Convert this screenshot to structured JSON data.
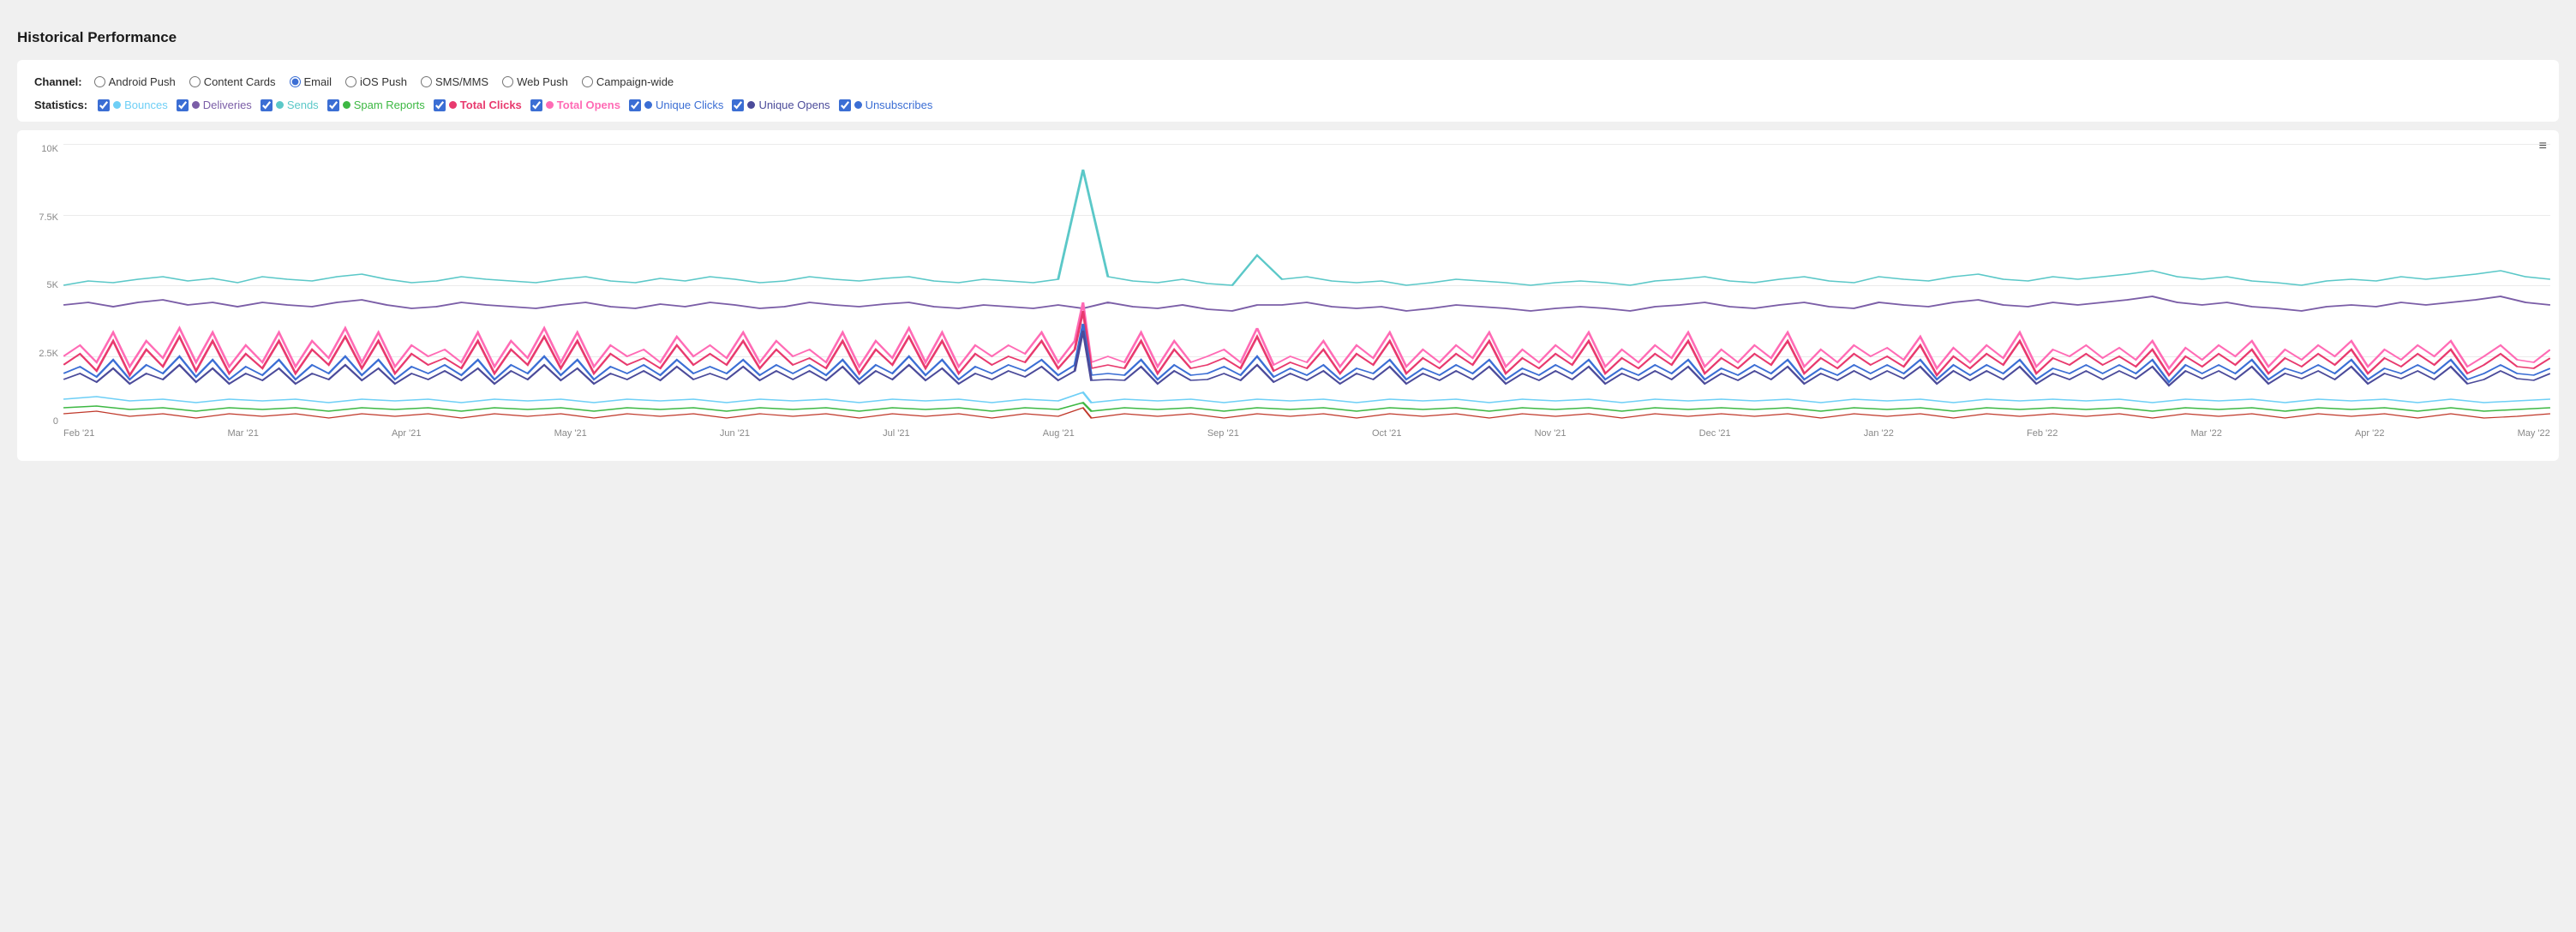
{
  "page": {
    "title": "Historical Performance"
  },
  "channel": {
    "label": "Channel:",
    "options": [
      {
        "id": "android-push",
        "label": "Android Push",
        "checked": false
      },
      {
        "id": "content-cards",
        "label": "Content Cards",
        "checked": false
      },
      {
        "id": "email",
        "label": "Email",
        "checked": true
      },
      {
        "id": "ios-push",
        "label": "iOS Push",
        "checked": false
      },
      {
        "id": "sms-mms",
        "label": "SMS/MMS",
        "checked": false
      },
      {
        "id": "web-push",
        "label": "Web Push",
        "checked": false
      },
      {
        "id": "campaign-wide",
        "label": "Campaign-wide",
        "checked": false
      }
    ]
  },
  "statistics": {
    "label": "Statistics:",
    "options": [
      {
        "id": "bounces",
        "label": "Bounces",
        "color": "#6ecff6",
        "checked": true
      },
      {
        "id": "deliveries",
        "label": "Deliveries",
        "color": "#7b5ea7",
        "checked": true
      },
      {
        "id": "sends",
        "label": "Sends",
        "color": "#5bc8c8",
        "checked": true
      },
      {
        "id": "spam-reports",
        "label": "Spam Reports",
        "color": "#3db843",
        "checked": true
      },
      {
        "id": "total-clicks",
        "label": "Total Clicks",
        "color": "#e83a6e",
        "checked": true
      },
      {
        "id": "total-opens",
        "label": "Total Opens",
        "color": "#e83a6e",
        "checked": true
      },
      {
        "id": "unique-clicks",
        "label": "Unique Clicks",
        "color": "#3b6ed4",
        "checked": true
      },
      {
        "id": "unique-opens",
        "label": "Unique Opens",
        "color": "#4b4b9a",
        "checked": true
      },
      {
        "id": "unsubscribes",
        "label": "Unsubscribes",
        "color": "#3b6ed4",
        "checked": true
      }
    ]
  },
  "chart": {
    "menu_icon": "≡",
    "y_labels": [
      "10K",
      "7.5K",
      "5K",
      "2.5K",
      "0"
    ],
    "x_labels": [
      "Feb '21",
      "Mar '21",
      "Apr '21",
      "May '21",
      "Jun '21",
      "Jul '21",
      "Aug '21",
      "Sep '21",
      "Oct '21",
      "Nov '21",
      "Dec '21",
      "Jan '22",
      "Feb '22",
      "Mar '22",
      "Apr '22",
      "May '22"
    ]
  }
}
